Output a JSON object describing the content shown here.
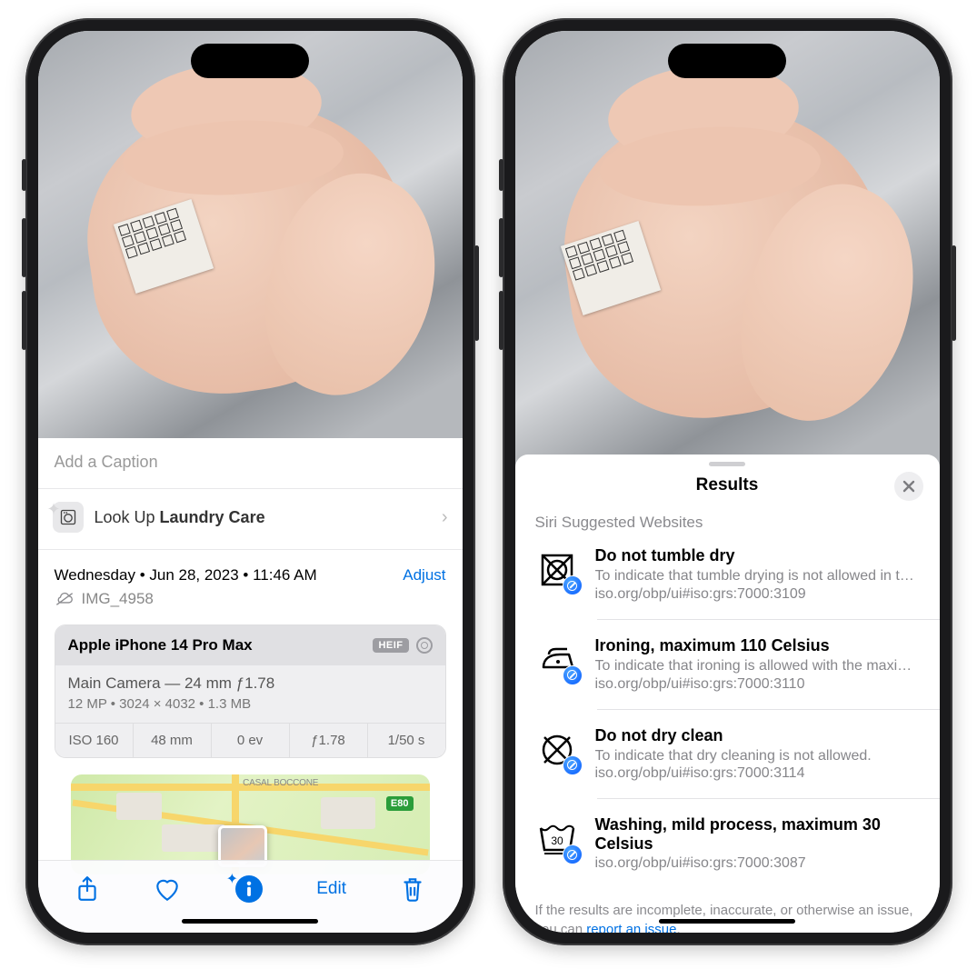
{
  "phone1": {
    "caption_placeholder": "Add a Caption",
    "lookup": {
      "prefix": "Look Up ",
      "subject": "Laundry Care"
    },
    "date_line": "Wednesday • Jun 28, 2023 • 11:46 AM",
    "adjust": "Adjust",
    "filename": "IMG_4958",
    "camera": {
      "device": "Apple iPhone 14 Pro Max",
      "format": "HEIF",
      "lens": "Main Camera — 24 mm ƒ1.78",
      "dims": "12 MP  •  3024 × 4032  •  1.3 MB",
      "cells": [
        "ISO 160",
        "48 mm",
        "0 ev",
        "ƒ1.78",
        "1/50 s"
      ]
    },
    "map": {
      "area": "CASAL BOCCONE",
      "route": "E80"
    },
    "toolbar": {
      "edit": "Edit"
    }
  },
  "phone2": {
    "sheet_title": "Results",
    "section": "Siri Suggested Websites",
    "results": [
      {
        "title": "Do not tumble dry",
        "desc": "To indicate that tumble drying is not allowed in the…",
        "url": "iso.org/obp/ui#iso:grs:7000:3109"
      },
      {
        "title": "Ironing, maximum 110 Celsius",
        "desc": "To indicate that ironing is allowed with the maximu…",
        "url": "iso.org/obp/ui#iso:grs:7000:3110"
      },
      {
        "title": "Do not dry clean",
        "desc": "To indicate that dry cleaning is not allowed.",
        "url": "iso.org/obp/ui#iso:grs:7000:3114"
      },
      {
        "title": "Washing, mild process, maximum 30 Celsius",
        "desc": "",
        "url": "iso.org/obp/ui#iso:grs:7000:3087"
      }
    ],
    "footer_a": "If the results are incomplete, inaccurate, or otherwise an issue, you can ",
    "footer_link": "report an issue",
    "footer_b": "."
  }
}
